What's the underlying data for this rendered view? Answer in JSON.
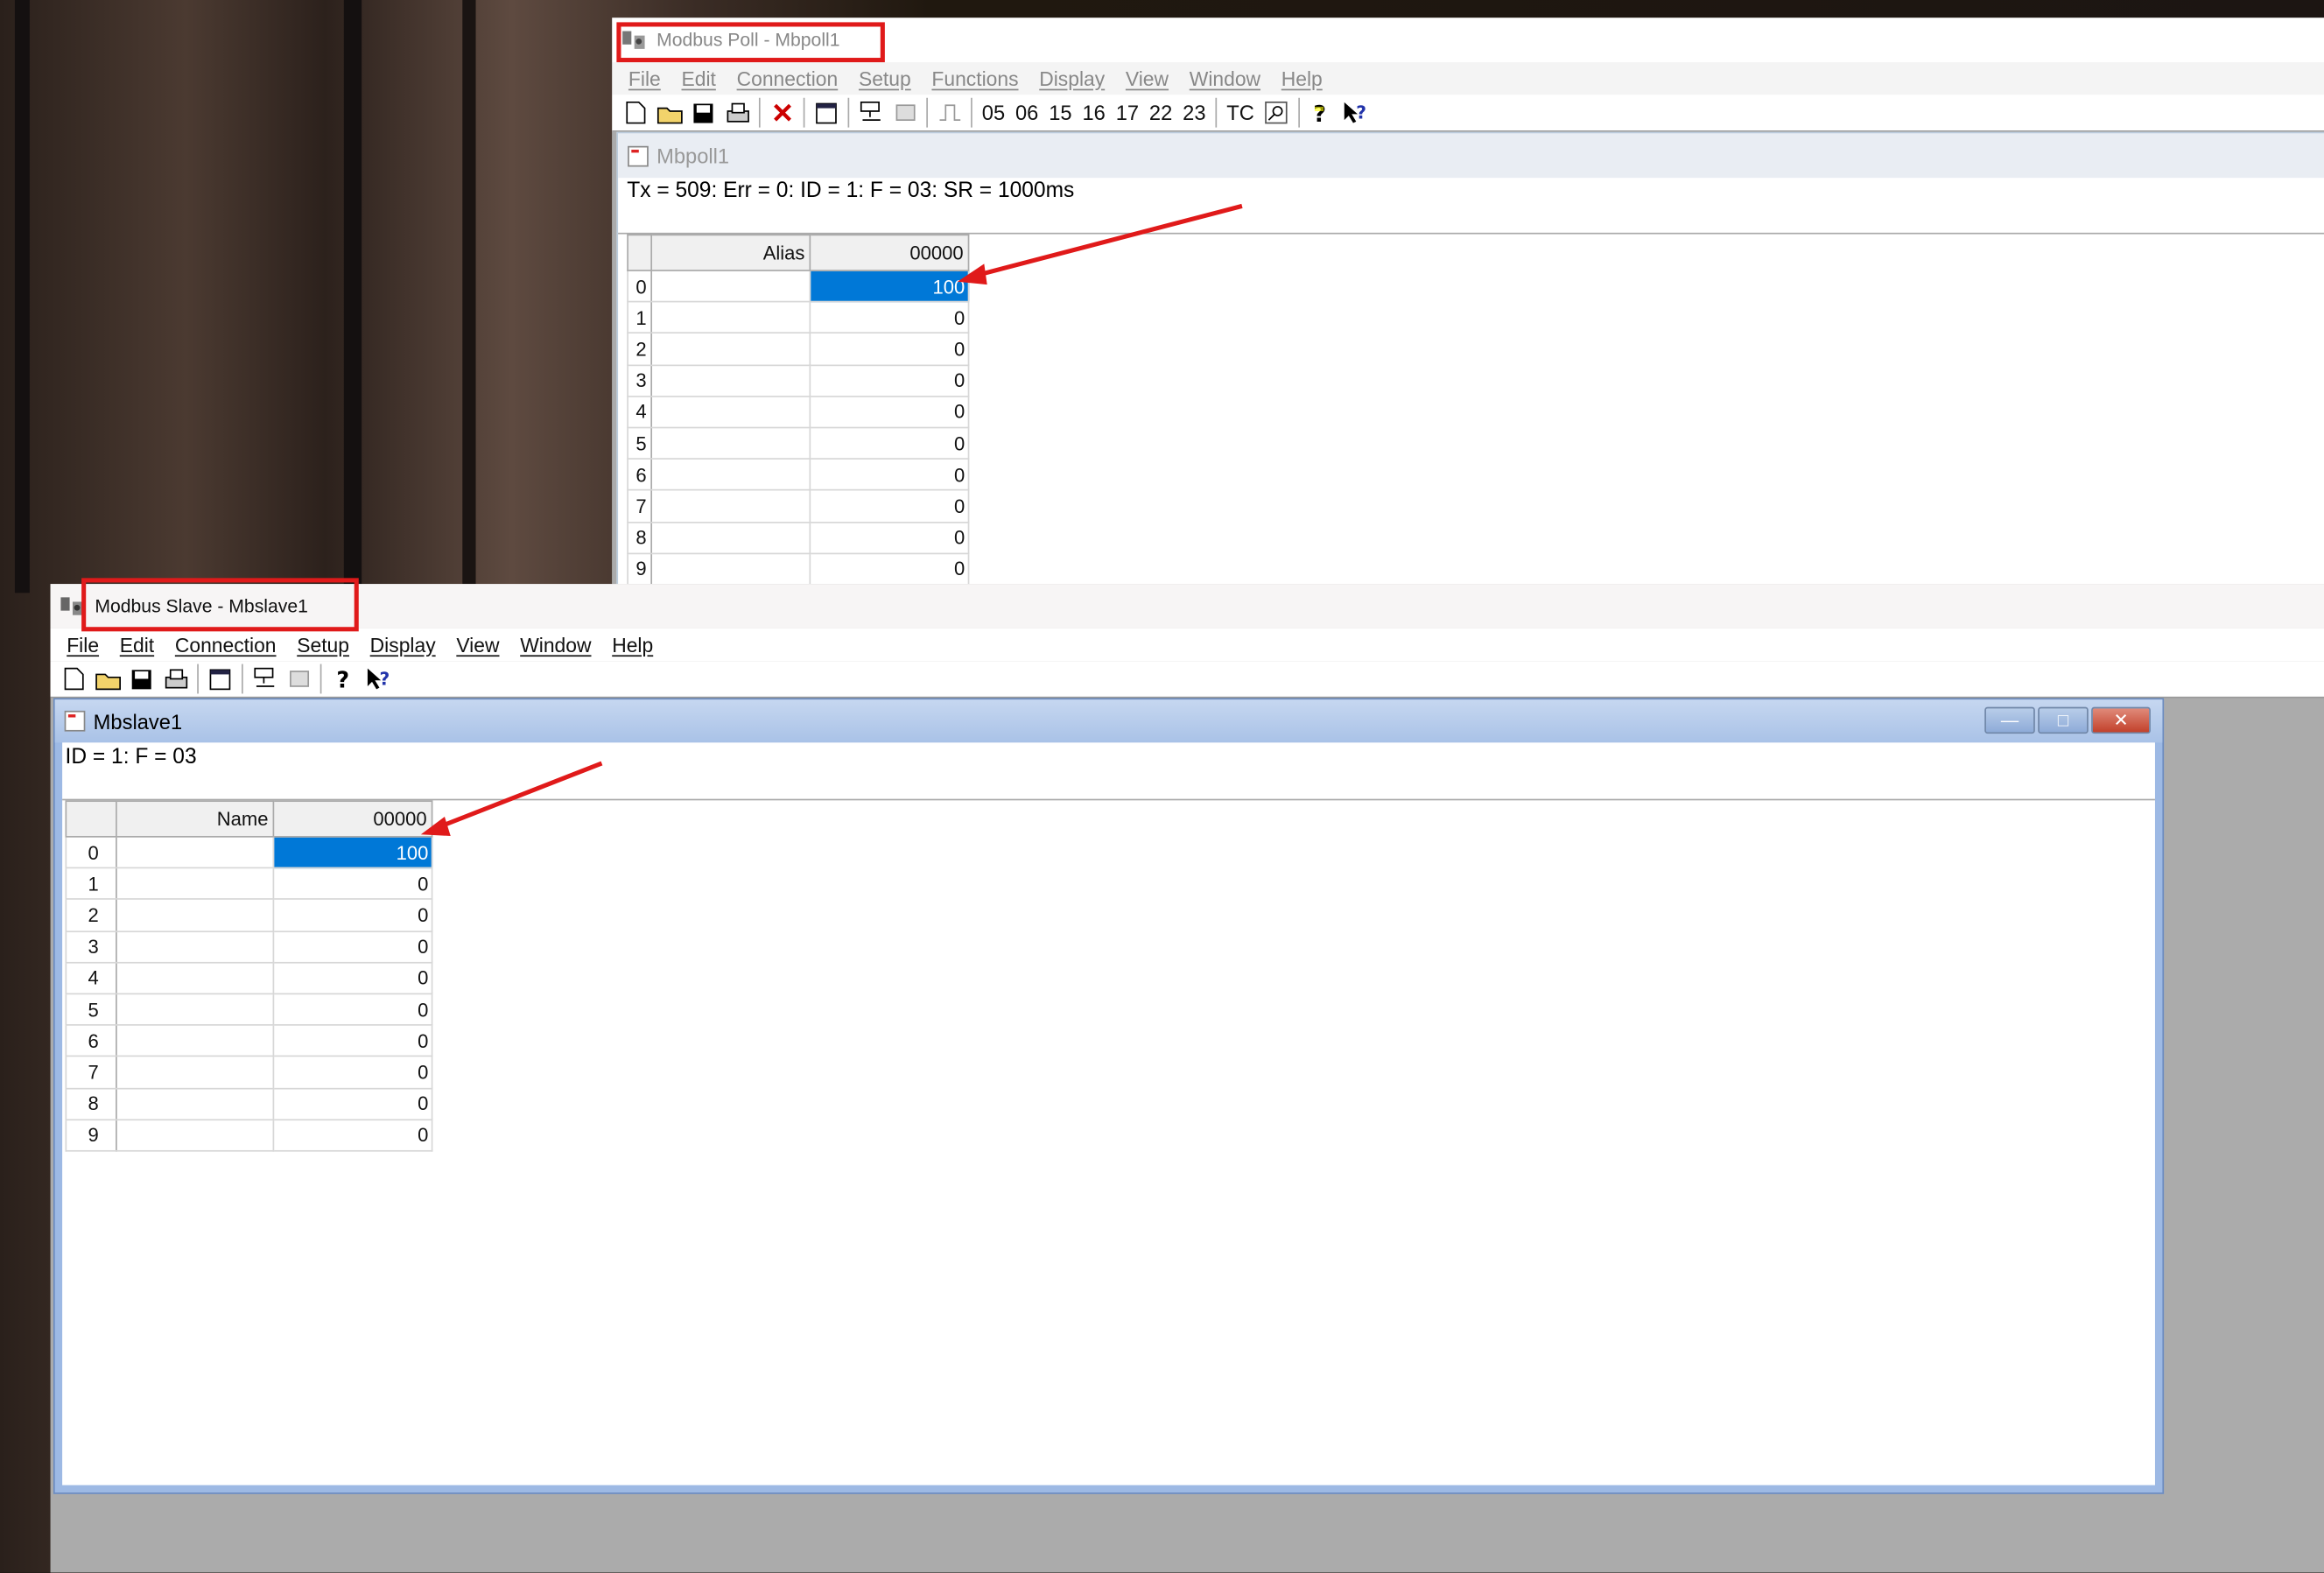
{
  "poll_window": {
    "title": "Modbus Poll - Mbpoll1",
    "menu": [
      "File",
      "Edit",
      "Connection",
      "Setup",
      "Functions",
      "Display",
      "View",
      "Window",
      "Help"
    ],
    "toolbar_codes": [
      "05",
      "06",
      "15",
      "16",
      "17",
      "22",
      "23",
      "TC"
    ],
    "child_title": "Mbpoll1",
    "status": "Tx = 509: Err = 0: ID = 1: F = 03: SR = 1000ms",
    "col_name_header": "Alias",
    "col_value_header": "00000",
    "rows": [
      {
        "index": "0",
        "value": "100"
      },
      {
        "index": "1",
        "value": "0"
      },
      {
        "index": "2",
        "value": "0"
      },
      {
        "index": "3",
        "value": "0"
      },
      {
        "index": "4",
        "value": "0"
      },
      {
        "index": "5",
        "value": "0"
      },
      {
        "index": "6",
        "value": "0"
      },
      {
        "index": "7",
        "value": "0"
      },
      {
        "index": "8",
        "value": "0"
      },
      {
        "index": "9",
        "value": "0"
      }
    ]
  },
  "slave_window": {
    "title": "Modbus Slave - Mbslave1",
    "menu": [
      "File",
      "Edit",
      "Connection",
      "Setup",
      "Display",
      "View",
      "Window",
      "Help"
    ],
    "child_title": "Mbslave1",
    "status": "ID = 1: F = 03",
    "col_name_header": "Name",
    "col_value_header": "00000",
    "rows": [
      {
        "index": "0",
        "value": "100"
      },
      {
        "index": "1",
        "value": "0"
      },
      {
        "index": "2",
        "value": "0"
      },
      {
        "index": "3",
        "value": "0"
      },
      {
        "index": "4",
        "value": "0"
      },
      {
        "index": "5",
        "value": "0"
      },
      {
        "index": "6",
        "value": "0"
      },
      {
        "index": "7",
        "value": "0"
      },
      {
        "index": "8",
        "value": "0"
      },
      {
        "index": "9",
        "value": "0"
      }
    ]
  },
  "colors": {
    "selection": "#0078d7",
    "annotation": "#e01a1a",
    "mdi_background": "#ababab",
    "child_frame": "#9db9e4"
  }
}
